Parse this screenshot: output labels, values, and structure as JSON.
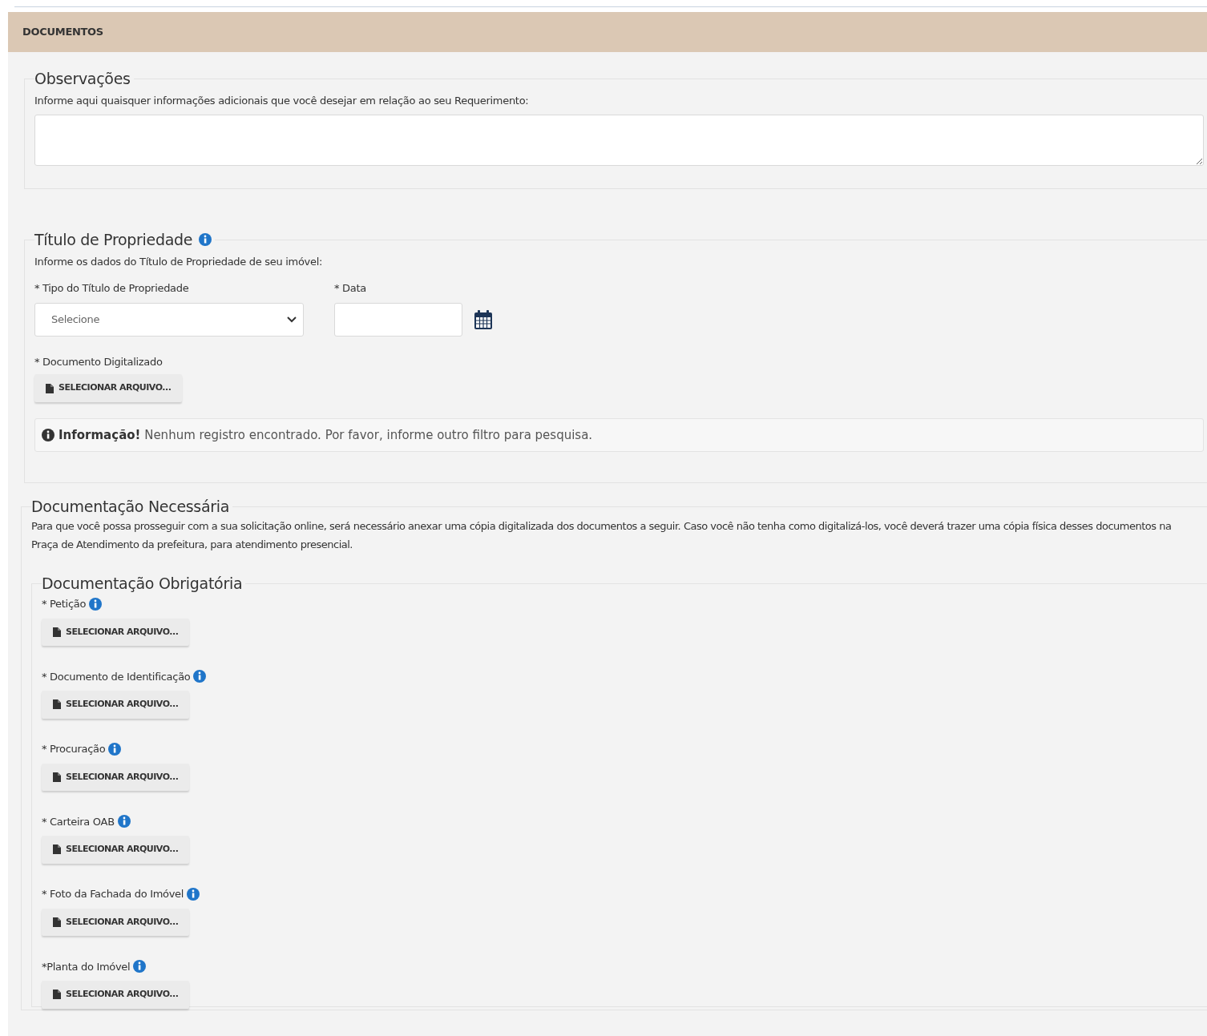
{
  "header": {
    "title": "DOCUMENTOS"
  },
  "observacoes": {
    "legend": "Observações",
    "hint": "Informe aqui quaisquer informações adicionais que você desejar em relação ao seu Requerimento:"
  },
  "titulo": {
    "legend": "Título de Propriedade",
    "intro": "Informe os dados do Título de Propriedade de seu imóvel:",
    "fields": [
      {
        "kind": "select",
        "label": "* Tipo do Título de Propriedade",
        "option": "Selecione"
      },
      {
        "kind": "date",
        "label": "* Data"
      }
    ],
    "upload": {
      "label": "* Documento Digitalizado",
      "button": "SELECIONAR ARQUIVO..."
    },
    "alert": {
      "title": "Informação!",
      "message": "Nenhum registro encontrado. Por favor, informe outro filtro para pesquisa."
    }
  },
  "necessaria": {
    "legend": "Documentação Necessária",
    "text": "Para que você possa prosseguir com a sua solicitação online, será necessário anexar uma cópia digitalizada dos documentos a seguir. Caso você não tenha como digitalizá-los, você deverá trazer uma cópia física desses documentos na Praça de Atendimento da prefeitura, para atendimento presencial.",
    "obrigatoria": {
      "legend": "Documentação Obrigatória",
      "items": [
        {
          "label": "* Petição",
          "button": "SELECIONAR ARQUIVO..."
        },
        {
          "label": "* Documento de Identificação",
          "button": "SELECIONAR ARQUIVO..."
        },
        {
          "label": "* Procuração",
          "button": "SELECIONAR ARQUIVO..."
        },
        {
          "label": "* Carteira OAB",
          "button": "SELECIONAR ARQUIVO..."
        },
        {
          "label": "* Foto da Fachada do Imóvel",
          "button": "SELECIONAR ARQUIVO..."
        },
        {
          "label": "*Planta do Imóvel",
          "button": "SELECIONAR ARQUIVO..."
        }
      ]
    }
  }
}
